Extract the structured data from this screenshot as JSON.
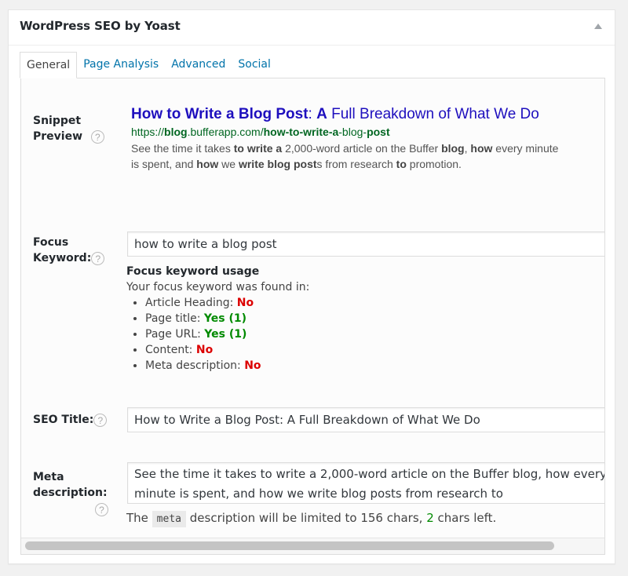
{
  "metabox": {
    "title": "WordPress SEO by Yoast",
    "toggle_icon": "triangle-up-icon"
  },
  "tabs": [
    {
      "label": "General",
      "active": true
    },
    {
      "label": "Page Analysis",
      "active": false
    },
    {
      "label": "Advanced",
      "active": false
    },
    {
      "label": "Social",
      "active": false
    }
  ],
  "snippet_preview": {
    "label_line1": "Snippet",
    "label_line2": "Preview",
    "help_icon": "?",
    "title_parts": [
      {
        "text": "How to Write a Blog Post",
        "bold": true
      },
      {
        "text": ": ",
        "bold": false
      },
      {
        "text": "A",
        "bold": true
      },
      {
        "text": " Full Breakdown of What We Do",
        "bold": false
      }
    ],
    "url_parts": [
      {
        "text": "https://",
        "bold": false
      },
      {
        "text": "blog",
        "bold": true
      },
      {
        "text": ".bufferapp.com/",
        "bold": false
      },
      {
        "text": "how-to-write-a",
        "bold": true
      },
      {
        "text": "-blog-",
        "bold": false
      },
      {
        "text": "post",
        "bold": true
      }
    ],
    "desc_line1_parts": [
      {
        "text": "See the time it takes ",
        "bold": false
      },
      {
        "text": "to write a",
        "bold": true
      },
      {
        "text": " 2,000-word article on the Buffer ",
        "bold": false
      },
      {
        "text": "blog",
        "bold": true
      },
      {
        "text": ", ",
        "bold": false
      },
      {
        "text": "how",
        "bold": true
      },
      {
        "text": " every minute",
        "bold": false
      }
    ],
    "desc_line2_parts": [
      {
        "text": "is spent, and ",
        "bold": false
      },
      {
        "text": "how",
        "bold": true
      },
      {
        "text": " we ",
        "bold": false
      },
      {
        "text": "write blog post",
        "bold": true
      },
      {
        "text": "s from research ",
        "bold": false
      },
      {
        "text": "to",
        "bold": true
      },
      {
        "text": " promotion.",
        "bold": false
      }
    ]
  },
  "focus_keyword": {
    "label_line1": "Focus",
    "label_line2": "Keyword:",
    "help_icon": "?",
    "value": "how to write a blog post",
    "usage_heading": "Focus keyword usage",
    "usage_intro": "Your focus keyword was found in:",
    "usage_items": [
      {
        "label": "Article Heading: ",
        "result": "No",
        "status": "no"
      },
      {
        "label": "Page title: ",
        "result": "Yes (1)",
        "status": "yes"
      },
      {
        "label": "Page URL: ",
        "result": "Yes (1)",
        "status": "yes"
      },
      {
        "label": "Content: ",
        "result": "No",
        "status": "no"
      },
      {
        "label": "Meta description: ",
        "result": "No",
        "status": "no"
      }
    ]
  },
  "seo_title": {
    "label": "SEO Title:",
    "help_icon": "?",
    "value": "How to Write a Blog Post: A Full Breakdown of What We Do"
  },
  "meta_description": {
    "label_line1": "Meta",
    "label_line2": "description:",
    "help_icon": "?",
    "value": "See the time it takes to write a 2,000-word article on the Buffer blog, how every minute is spent, and how we write blog posts from research to",
    "note_prefix": "The ",
    "note_code": "meta",
    "note_middle": " description will be limited to 156 chars, ",
    "chars_left": "2",
    "note_suffix": " chars left."
  },
  "colors": {
    "link": "#0073aa",
    "snippet_title": "#1e0fbe",
    "snippet_url": "#006621",
    "status_no": "#dc0000",
    "status_yes": "#008a00"
  },
  "scrollbar": {
    "horizontal_visible_fraction": 0.92
  }
}
